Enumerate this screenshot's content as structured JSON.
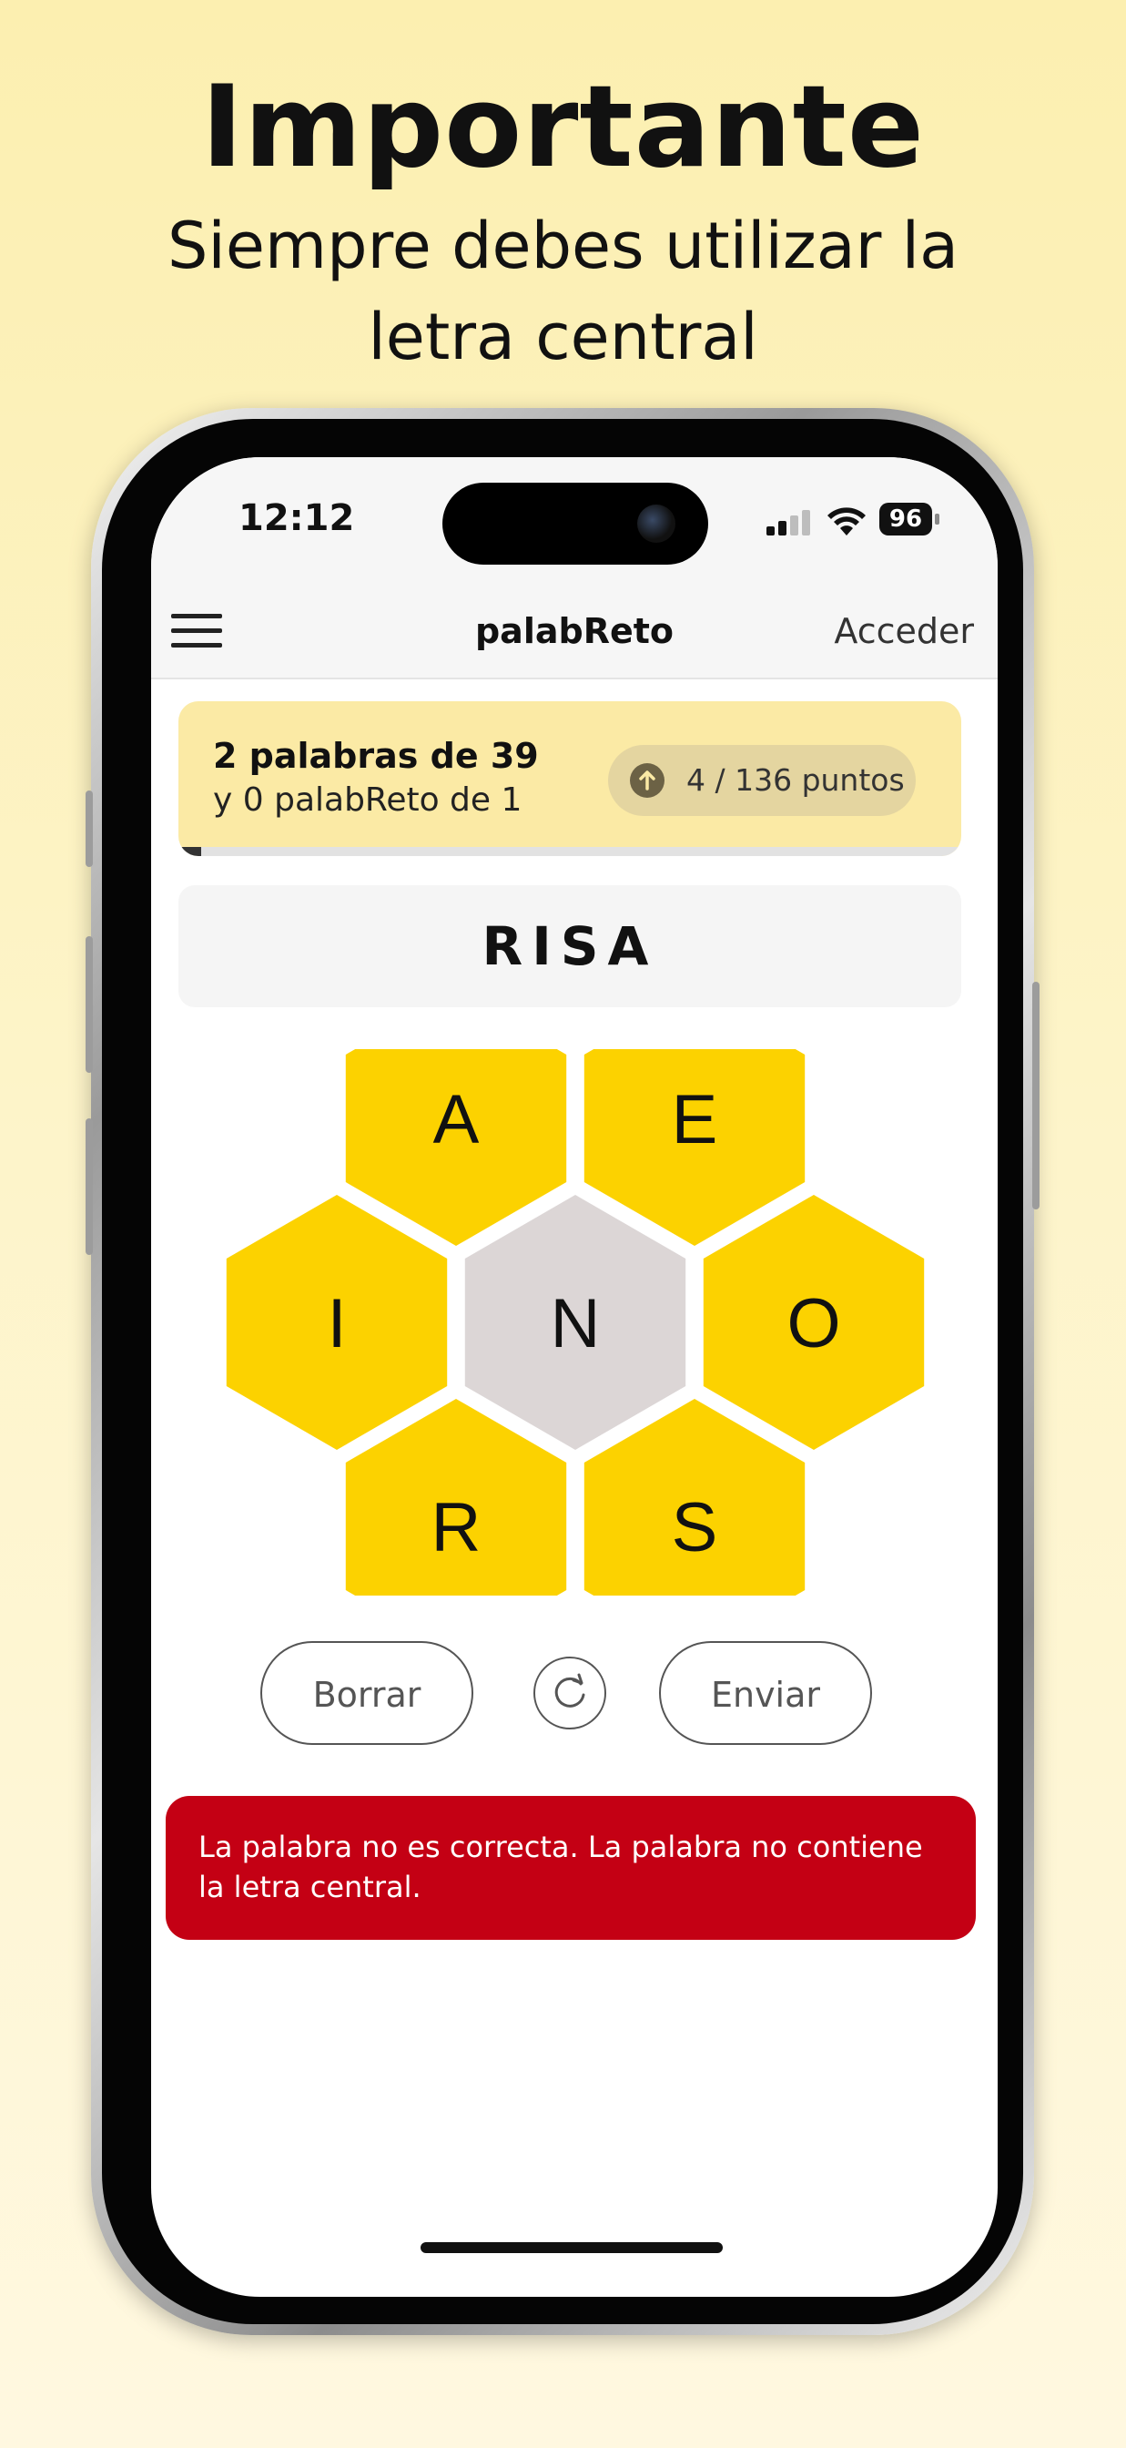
{
  "promo": {
    "title": "Importante",
    "subtitle": "Siempre debes utilizar la letra central"
  },
  "status_bar": {
    "time": "12:12",
    "battery": "96",
    "icons": [
      "signal-icon",
      "wifi-icon",
      "battery-icon"
    ]
  },
  "nav": {
    "title": "palabReto",
    "login_label": "Acceder",
    "menu_icon": "hamburger-menu-icon"
  },
  "score": {
    "words_found": "2 palabras de 39",
    "palabreto_found": "y 0 palabReto de 1",
    "points": "4 / 136 puntos",
    "points_icon": "arrow-up-circle-icon",
    "progress": 0.029
  },
  "current_word": "RISA",
  "hive": {
    "center_letter": "N",
    "outer_letters": [
      "A",
      "E",
      "I",
      "O",
      "R",
      "S"
    ]
  },
  "controls": {
    "delete_label": "Borrar",
    "submit_label": "Enviar",
    "shuffle_icon": "shuffle-refresh-icon"
  },
  "toast": {
    "message": "La palabra no es correcta. La palabra no contiene la letra central."
  },
  "colors": {
    "background": "#fcefb0",
    "hex_outer": "#fcd200",
    "hex_center": "#dcd6d6",
    "score_card": "#fbeaa5",
    "toast": "#c40014"
  }
}
